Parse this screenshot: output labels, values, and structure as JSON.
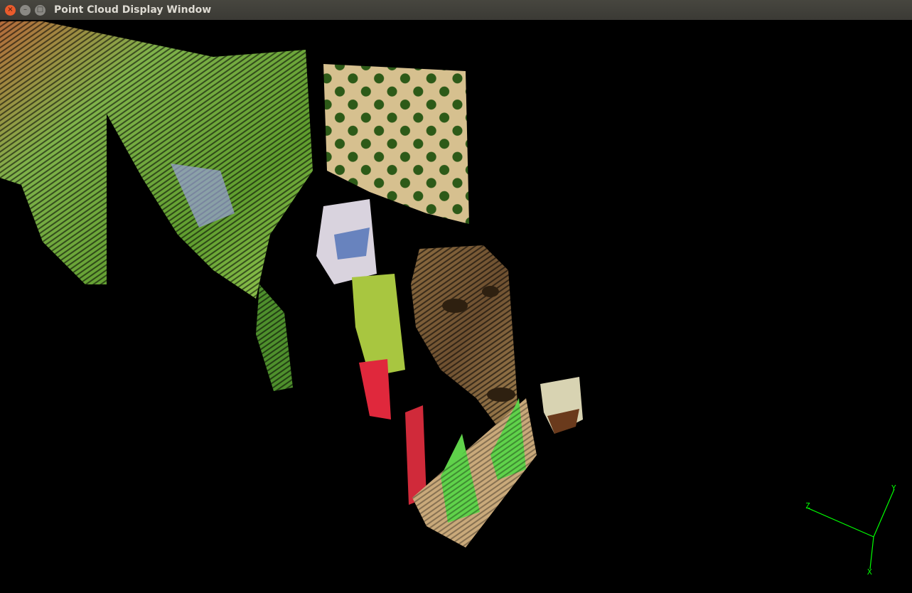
{
  "window": {
    "title": "Point Cloud Display Window",
    "buttons": {
      "close": "×",
      "minimize": "–",
      "maximize": "□"
    }
  },
  "axes": {
    "labels": {
      "x": "X",
      "y": "Y",
      "z": "Z"
    },
    "color": "#00ff00"
  },
  "colors": {
    "background": "#000000",
    "titlebar": "#3e3d38",
    "close": "#e95b2c"
  }
}
